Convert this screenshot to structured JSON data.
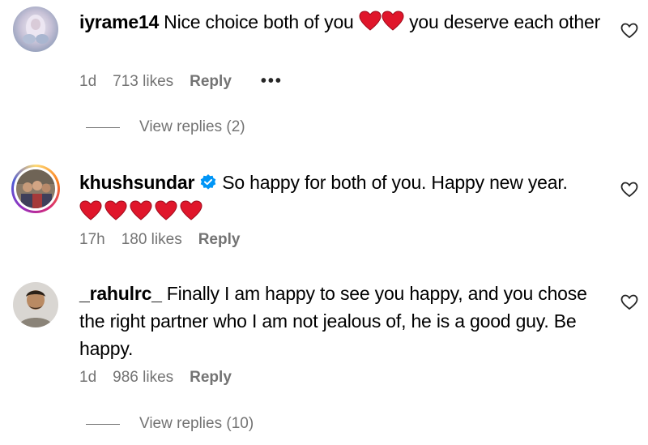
{
  "comments": [
    {
      "username": "iyrame14",
      "text_before_hearts": "Nice choice both of you",
      "text_after_hearts": "you deserve each other",
      "time": "1d",
      "likes": "713 likes",
      "reply_label": "Reply",
      "more_label": "•••",
      "view_replies": "View replies (2)"
    },
    {
      "username": "khushsundar",
      "text": "So happy for both of you. Happy new year.",
      "time": "17h",
      "likes": "180 likes",
      "reply_label": "Reply"
    },
    {
      "username": "_rahulrc_",
      "text": "Finally I am happy to see you happy, and you chose the right partner who I am not jealous of, he is a good guy. Be happy.",
      "time": "1d",
      "likes": "986 likes",
      "reply_label": "Reply",
      "view_replies": "View replies (10)"
    }
  ],
  "colors": {
    "heart_red": "#e0162b",
    "meta_gray": "#737373",
    "verified_blue": "#0095f6"
  },
  "icons": {
    "like": "heart-outline-icon",
    "verified": "verified-badge-icon",
    "emoji": "red-heart-emoji"
  }
}
